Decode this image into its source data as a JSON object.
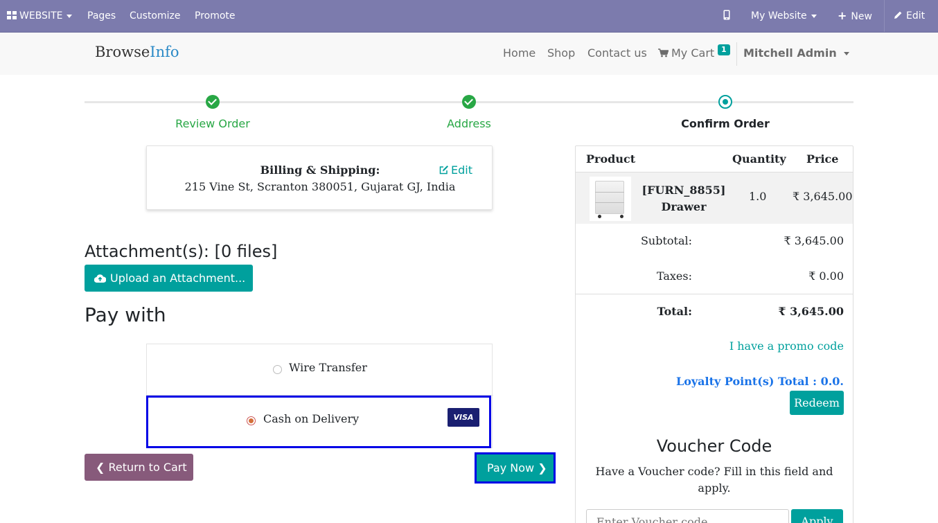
{
  "admin_bar": {
    "website_label": "WEBSITE",
    "pages_label": "Pages",
    "customize_label": "Customize",
    "promote_label": "Promote",
    "my_website_label": "My Website",
    "new_label": "New",
    "edit_label": "Edit",
    "background_color": "#7c7bad"
  },
  "header": {
    "logo_part1": "Browse",
    "logo_part2": "Info",
    "nav": {
      "home": "Home",
      "shop": "Shop",
      "contact": "Contact us",
      "cart": "My Cart",
      "cart_count": "1"
    },
    "user": "Mitchell Admin"
  },
  "wizard": {
    "steps": [
      {
        "label": "Review Order",
        "state": "done"
      },
      {
        "label": "Address",
        "state": "done"
      },
      {
        "label": "Confirm Order",
        "state": "current"
      }
    ]
  },
  "billing": {
    "title": "Billing & Shipping:",
    "edit_label": "Edit",
    "address": "215 Vine St, Scranton 380051, Gujarat GJ, India"
  },
  "attachments": {
    "title": "Attachment(s): [0 files]",
    "upload_label": "Upload an Attachment..."
  },
  "payment": {
    "title": "Pay with",
    "options": [
      {
        "label": "Wire Transfer",
        "selected": false
      },
      {
        "label": "Cash on Delivery",
        "selected": true,
        "badge": "VISA"
      }
    ],
    "return_label": "Return to Cart",
    "pay_now_label": "Pay Now"
  },
  "summary": {
    "headers": {
      "product": "Product",
      "quantity": "Quantity",
      "price": "Price"
    },
    "items": [
      {
        "name": "[FURN_8855] Drawer",
        "quantity": "1.0",
        "price": "₹ 3,645.00"
      }
    ],
    "subtotal_label": "Subtotal:",
    "subtotal_value": "₹ 3,645.00",
    "taxes_label": "Taxes:",
    "taxes_value": "₹ 0.00",
    "total_label": "Total:",
    "total_value": "₹ 3,645.00",
    "promo_label": "I have a promo code",
    "loyalty_label": "Loyalty Point(s) Total : 0.0.",
    "redeem_label": "Redeem",
    "voucher_title": "Voucher Code",
    "voucher_text": "Have a Voucher code? Fill in this field and apply.",
    "voucher_placeholder": "Enter Voucher code",
    "apply_label": "Apply"
  },
  "colors": {
    "primary": "#00a09d",
    "secondary": "#875a7b",
    "success": "#28a745",
    "highlight_border": "#0000e6"
  }
}
